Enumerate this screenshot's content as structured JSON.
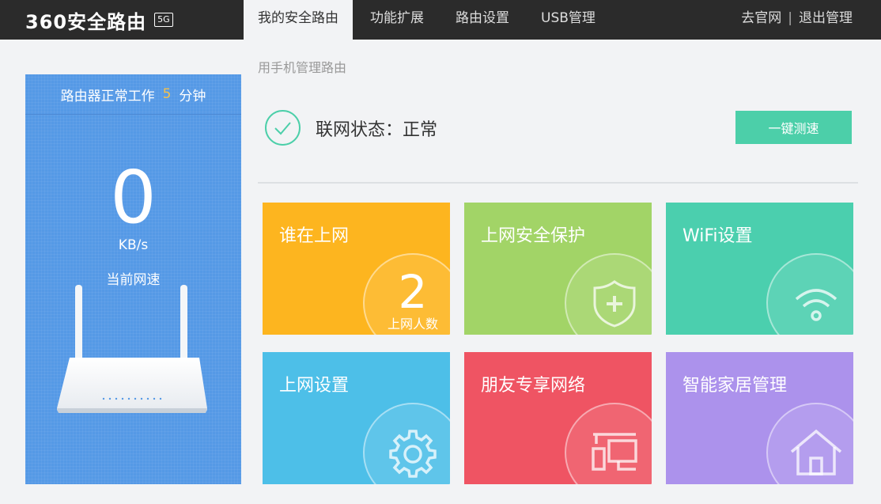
{
  "header": {
    "brand": "360安全路由",
    "badge": "5G",
    "tabs": [
      {
        "label": "我的安全路由"
      },
      {
        "label": "功能扩展"
      },
      {
        "label": "路由设置"
      },
      {
        "label": "USB管理"
      }
    ],
    "links": {
      "official": "去官网",
      "separator": "|",
      "logout": "退出管理"
    }
  },
  "left": {
    "uptime_prefix": "路由器正常工作",
    "uptime_value": "5",
    "uptime_unit": "分钟",
    "speed_value": "0",
    "speed_unit": "KB/s",
    "speed_label": "当前网速"
  },
  "main": {
    "subtitle": "用手机管理路由",
    "status_text": "联网状态：正常",
    "speedtest_label": "一键测速",
    "tiles": [
      {
        "title": "谁在上网",
        "count": "2",
        "count_label": "上网人数",
        "color": "#fdb51f"
      },
      {
        "title": "上网安全保护",
        "color": "#a2d467",
        "icon": "shield-plus-icon"
      },
      {
        "title": "WiFi设置",
        "color": "#4bcfae",
        "icon": "wifi-icon"
      },
      {
        "title": "上网设置",
        "color": "#4dbfe8",
        "icon": "gear-icon"
      },
      {
        "title": "朋友专享网络",
        "color": "#ef5463",
        "icon": "devices-icon"
      },
      {
        "title": "智能家居管理",
        "color": "#ac92ec",
        "icon": "house-icon"
      }
    ]
  },
  "colors": {
    "accent": "#4ccfa9",
    "panel": "#5599e6",
    "topbar": "#2b2b2b"
  }
}
